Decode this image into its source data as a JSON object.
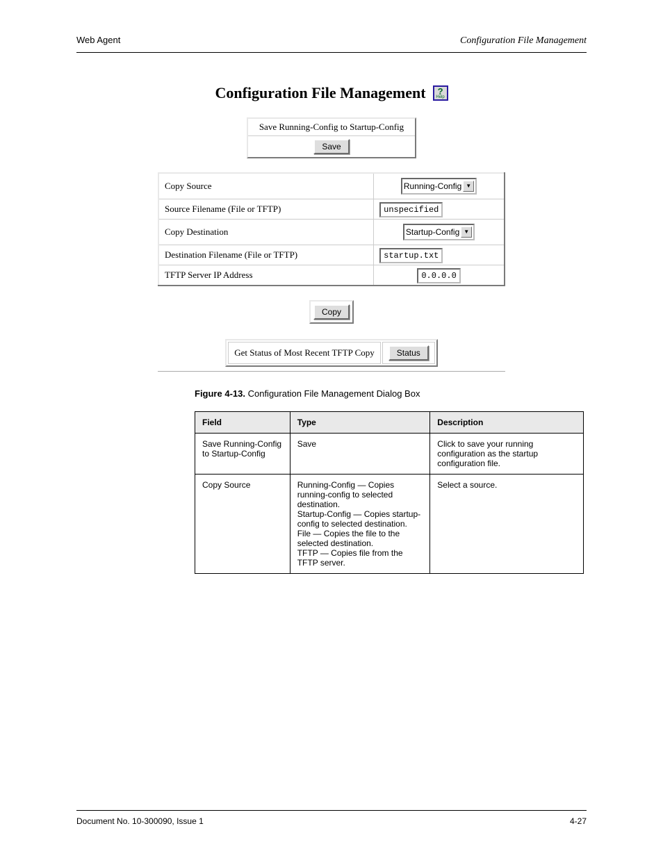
{
  "header": {
    "left": "Web Agent",
    "right": "Configuration File Management"
  },
  "screenshot": {
    "title": "Configuration File Management",
    "help_label": "Help",
    "save_section": {
      "caption": "Save Running-Config to Startup-Config",
      "button": "Save"
    },
    "form": {
      "rows": [
        {
          "label": "Copy Source",
          "type": "select",
          "value": "Running-Config"
        },
        {
          "label": "Source Filename (File or TFTP)",
          "type": "text",
          "value": "unspecified",
          "cls": "wide-input"
        },
        {
          "label": "Copy Destination",
          "type": "select",
          "value": "Startup-Config"
        },
        {
          "label": "Destination Filename (File or TFTP)",
          "type": "text",
          "value": "startup.txt",
          "cls": "wide-input"
        },
        {
          "label": "TFTP Server IP Address",
          "type": "text",
          "value": "0.0.0.0",
          "cls": "short-input"
        }
      ]
    },
    "copy_button": "Copy",
    "status_section": {
      "caption": "Get Status of Most Recent TFTP Copy",
      "button": "Status"
    }
  },
  "figure_caption": {
    "num": "Figure 4-13.",
    "text": "Configuration File Management Dialog Box"
  },
  "info_table": {
    "headers": [
      "Field",
      "Type",
      "Description"
    ],
    "rows": [
      [
        "Save Running-Config to Startup-Config",
        "Save",
        "Click to save your running configuration as the startup configuration file."
      ],
      [
        "Copy Source",
        "Running-Config — Copies running-config to selected destination.\nStartup-Config — Copies startup-config to selected destination.\nFile — Copies the file to the selected destination.\nTFTP — Copies file from the TFTP server.",
        "Select a source."
      ]
    ]
  },
  "footer": {
    "left": "Document No. 10-300090, Issue 1",
    "right": "4-27"
  }
}
